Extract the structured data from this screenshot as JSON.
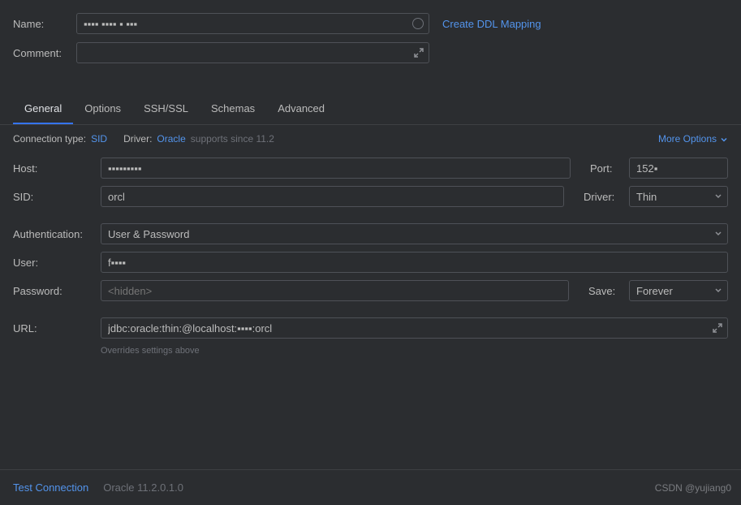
{
  "header": {
    "name_label": "Name:",
    "name_value": "▪▪▪▪ ▪▪▪▪ ▪ ▪▪▪",
    "ddl_link": "Create DDL Mapping",
    "comment_label": "Comment:",
    "comment_value": ""
  },
  "tabs": {
    "general": "General",
    "options": "Options",
    "ssh_ssl": "SSH/SSL",
    "schemas": "Schemas",
    "advanced": "Advanced"
  },
  "info_bar": {
    "conn_type_label": "Connection type:",
    "conn_type_value": "SID",
    "driver_label": "Driver:",
    "driver_value": "Oracle",
    "driver_note": "supports since 11.2",
    "more_options": "More Options"
  },
  "fields": {
    "host_label": "Host:",
    "host_value": "▪▪▪▪▪▪▪▪▪",
    "port_label": "Port:",
    "port_value": "152▪",
    "sid_label": "SID:",
    "sid_value": "orcl",
    "driver_label": "Driver:",
    "driver_value": "Thin",
    "auth_label": "Authentication:",
    "auth_value": "User & Password",
    "user_label": "User:",
    "user_value": "f▪▪▪▪",
    "password_label": "Password:",
    "password_placeholder": "<hidden>",
    "save_label": "Save:",
    "save_value": "Forever",
    "url_label": "URL:",
    "url_value": "jdbc:oracle:thin:@localhost:▪▪▪▪:orcl",
    "url_hint": "Overrides settings above"
  },
  "footer": {
    "test_connection": "Test Connection",
    "version": "Oracle 11.2.0.1.0"
  },
  "watermark": "CSDN @yujiang0"
}
